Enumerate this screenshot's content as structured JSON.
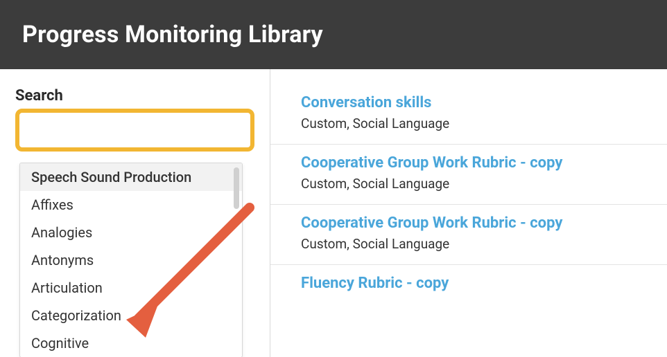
{
  "header": {
    "title": "Progress Monitoring Library"
  },
  "sidebar": {
    "search_label": "Search",
    "search_value": "",
    "dropdown": [
      "Speech Sound Production",
      "Affixes",
      "Analogies",
      "Antonyms",
      "Articulation",
      "Categorization",
      "Cognitive"
    ],
    "selected_index": 0
  },
  "results": [
    {
      "title": "Conversation skills",
      "meta": "Custom, Social Language"
    },
    {
      "title": "Cooperative Group Work Rubric - copy",
      "meta": "Custom, Social Language"
    },
    {
      "title": "Cooperative Group Work Rubric - copy",
      "meta": "Custom, Social Language"
    },
    {
      "title": "Fluency Rubric - copy",
      "meta": ""
    }
  ],
  "annotation": {
    "arrow_color": "#e45f3f"
  }
}
